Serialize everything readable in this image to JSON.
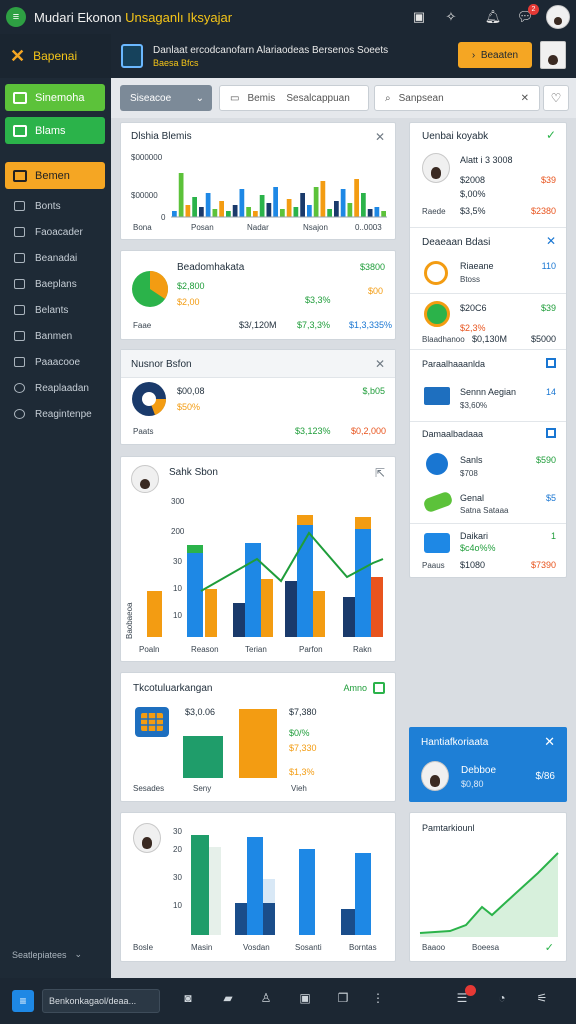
{
  "app": {
    "title_a": "Mudari Ekonon",
    "title_b": "Unsaganlı Iksyajar"
  },
  "topbar": {
    "notif_count": "2"
  },
  "sidebar": {
    "brand": "Bapenai",
    "btn1": "Sinemoha",
    "btn2": "Blams",
    "btn3": "Bemen",
    "items": [
      "Bonts",
      "Faoacader",
      "Beanadai",
      "Baeplans",
      "Belants",
      "Banmen",
      "Paaacooe",
      "Reaplaadan",
      "Reagintenpe"
    ],
    "footer": "Seatlepiatees"
  },
  "header": {
    "line1": "Danlaat ercodcanofarn Alariaodeas Bersenos Soeets",
    "line2": "Baesa  Bfcs",
    "cta": "Beaaten"
  },
  "filters": {
    "select": "Siseacoe",
    "input1_a": "Bemis",
    "input1_b": "Sesalcappuan",
    "input2": "Sanpsean"
  },
  "card1": {
    "title": "Dlshia  Blemis",
    "y_ticks": [
      "$000000",
      "$00000",
      "0"
    ],
    "x_labels": [
      "Bona",
      "Posan",
      "Nadar",
      "Nsajon",
      "0..0003"
    ]
  },
  "card2": {
    "title": "Beadomhakata",
    "headline": "$3800",
    "value_a": "$2,800",
    "value_b": "$2,00",
    "mid": "$3,3%",
    "side": "$00",
    "foot_lbl": "Faae",
    "foot": [
      "$3/,120M",
      "$7,3,3%",
      "$1,3,335%"
    ]
  },
  "card3": {
    "title": "Nusnor  Bsfon",
    "amount": "$00,08",
    "pct": "$50%",
    "right": "$,b05",
    "foot_lbl": "Paats",
    "foot": [
      "$3,123%",
      "$0,2,000"
    ]
  },
  "card4": {
    "title": "Sahk  Sbon",
    "y_ticks": [
      "300",
      "200",
      "30",
      "10",
      "10"
    ],
    "ylabel": "Baobaeoa",
    "x_labels": [
      "Poaln",
      "Reason",
      "Terian",
      "Parfon",
      "Rakn"
    ]
  },
  "card5": {
    "title": "Tkcotuluarkangan",
    "badge": "Amno",
    "value_left": "$3,0.06",
    "value_top": "$7,380",
    "pct1": "$0/%",
    "pct2": "$7,330",
    "pct3": "$1,3%",
    "x_labels": [
      "Sesades",
      "Seny",
      "Vieh"
    ]
  },
  "card6": {
    "y_ticks": [
      "30",
      "20",
      "30",
      "10"
    ],
    "x_labels": [
      "Bosle",
      "Masin",
      "Vosdan",
      "Sosanti",
      "Borntas"
    ]
  },
  "rp1": {
    "title": "Uenbai koyabk",
    "row1": {
      "name": "Alatt i 3 3008",
      "v1": "$2008",
      "v2": "$,00%",
      "right": "$39"
    },
    "foot_lbl": "Raede",
    "foot": [
      "$3,5%",
      "$2380"
    ]
  },
  "rp2": {
    "title": "Deaeaan  Bdasi",
    "row1": {
      "name": "Riaeane",
      "sub": "Btoss",
      "right": "110"
    },
    "row2": {
      "name": "$20C6",
      "sub": "$2,3%",
      "right": "$39"
    },
    "foot_lbl": "Blaadhanoo",
    "foot": [
      "$0,130M",
      "$5000"
    ]
  },
  "rp3": {
    "title": "Paraalhaaanlda",
    "row1": {
      "name": "Sennn Aegian",
      "sub": "$3,60%",
      "right": "14"
    }
  },
  "rp4": {
    "title": "Damaalbadaaa",
    "row1": {
      "name": "Sanls",
      "sub": "$708",
      "right": "$590"
    },
    "row2": {
      "name": "Genal",
      "sub": "Satna Sataaa",
      "right": "$5"
    },
    "row3": {
      "name": "Daikari",
      "sub": "$c4o%%",
      "right": "1"
    },
    "foot_lbl": "Paaus",
    "foot": [
      "$1080",
      "$7390"
    ]
  },
  "rp5": {
    "title": "Hantiafkoriaata",
    "name": "Debboe",
    "sub": "$0,80",
    "right": "$/86"
  },
  "rp6": {
    "title": "Pamtarkiounl",
    "x_labels": [
      "Baaoo",
      "Boeesa"
    ]
  },
  "taskbar": {
    "search": "Benkonkagaol/deaa..."
  },
  "colors": {
    "accent_green": "#2bb34a",
    "accent_orange": "#f5a623",
    "accent_blue": "#1e88e5",
    "dark_navy": "#1c2733"
  }
}
